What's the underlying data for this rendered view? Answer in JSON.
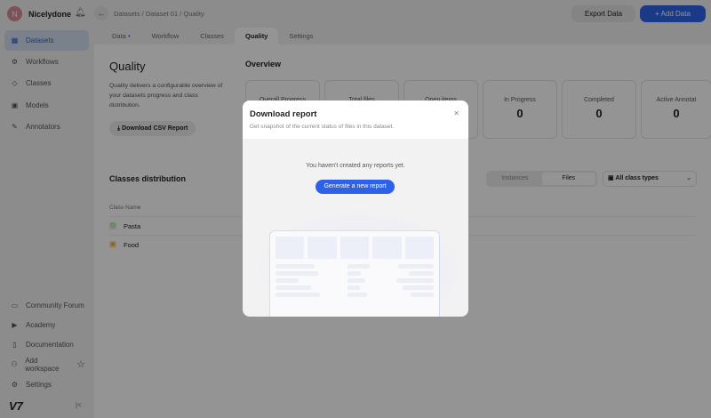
{
  "user": {
    "initial": "N",
    "name": "Nicelydone"
  },
  "sidebar": {
    "items": [
      {
        "label": "Datasets",
        "icon": "grid-icon"
      },
      {
        "label": "Workflows",
        "icon": "workflow-icon"
      },
      {
        "label": "Classes",
        "icon": "tag-icon"
      },
      {
        "label": "Models",
        "icon": "model-icon"
      },
      {
        "label": "Annotators",
        "icon": "pen-icon"
      }
    ],
    "bottom": [
      {
        "label": "Community Forum"
      },
      {
        "label": "Academy"
      },
      {
        "label": "Documentation"
      },
      {
        "label": "Add workspace"
      },
      {
        "label": "Settings"
      }
    ],
    "logo": "V7"
  },
  "breadcrumb": "Datasets / Dataset 01 / Quality",
  "header": {
    "export": "Export Data",
    "add": "+ Add Data"
  },
  "tabs": [
    "Data",
    "Workflow",
    "Classes",
    "Quality",
    "Settings"
  ],
  "quality": {
    "title": "Quality",
    "desc": "Quality delivers a configurable overview of your datasets progress and class distribution.",
    "csv": "Download CSV Report"
  },
  "overview": {
    "title": "Overview",
    "cards": [
      {
        "label": "Overall Progress",
        "value": ""
      },
      {
        "label": "Total files",
        "value": ""
      },
      {
        "label": "Open items",
        "value": ""
      },
      {
        "label": "In Progress",
        "value": "0"
      },
      {
        "label": "Completed",
        "value": "0"
      },
      {
        "label": "Active Annotat",
        "value": "0"
      }
    ]
  },
  "classes": {
    "title": "Classes distribution",
    "seg": [
      "Instances",
      "Files"
    ],
    "select": "All class types",
    "col": "Class Name",
    "rows": [
      {
        "name": "Pasta",
        "color": "#4caf50"
      },
      {
        "name": "Food",
        "color": "#f0a030"
      }
    ]
  },
  "modal": {
    "title": "Download report",
    "subtitle": "Get snapshot of the current status of files in this dataset.",
    "empty": "You haven't created any reports yet.",
    "generate": "Generate a new report"
  }
}
